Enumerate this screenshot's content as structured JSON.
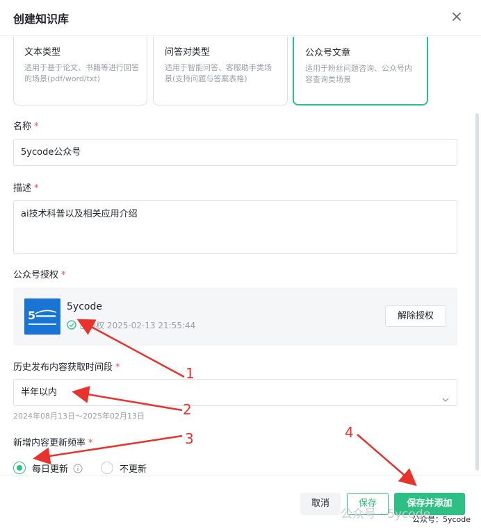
{
  "dialog": {
    "title": "创建知识库"
  },
  "type_cards": [
    {
      "title": "文本类型",
      "desc": "适用于基于论文、书籍等进行回答的场景(pdf/word/txt)"
    },
    {
      "title": "问答对类型",
      "desc": "适用于智能问答、客服助手类场景(支持问题与答案表格)"
    },
    {
      "title": "公众号文章",
      "desc": "适用于粉丝问题咨询、公众号内容查询类场景"
    }
  ],
  "form": {
    "name_label": "名称",
    "name_value": "5ycode公众号",
    "desc_label": "描述",
    "desc_value": "ai技术科普以及相关应用介绍",
    "auth_label": "公众号授权",
    "auth": {
      "account_name": "5ycode",
      "status_text": "已授权 2025-02-13 21:55:44",
      "unauth_button": "解除授权",
      "logo_text": "5 只是说说",
      "logo_subtext": "5YCODE.COM"
    },
    "history_label": "历史发布内容获取时间段",
    "history_value": "半年以内",
    "history_hint": "2024年08月13日～2025年02月13日",
    "frequency_label": "新增内容更新频率",
    "frequency_options": [
      {
        "label": "每日更新",
        "checked": true
      },
      {
        "label": "不更新",
        "checked": false
      }
    ],
    "required_mark": "*"
  },
  "footer": {
    "cancel": "取消",
    "save": "保存",
    "save_and_add": "保存并添加"
  },
  "annotations": [
    "1",
    "2",
    "3",
    "4"
  ],
  "watermark": {
    "main": "公众号 · 5ycode",
    "sub": "公众号：5ycode"
  },
  "colors": {
    "accent": "#2ebf84",
    "required": "#f54a45",
    "annotation": "#e8322b"
  }
}
